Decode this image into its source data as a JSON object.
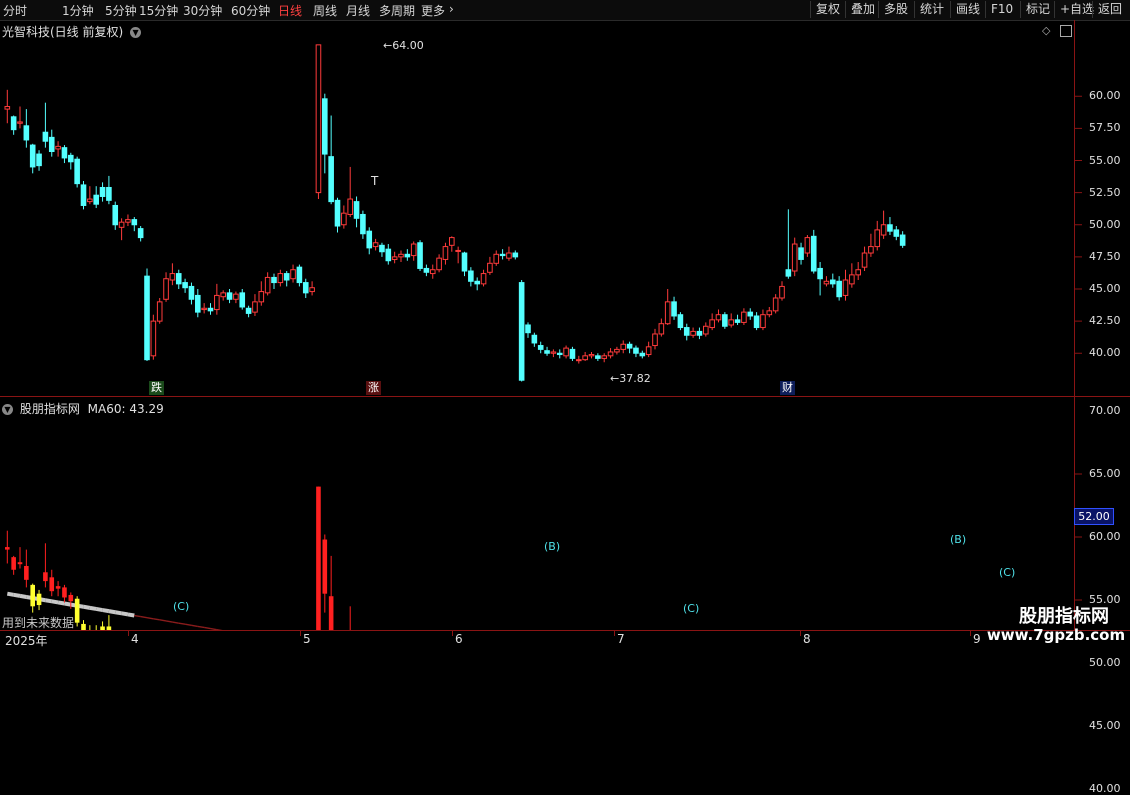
{
  "toolbar": {
    "left_items": [
      "分时",
      "1分钟",
      "5分钟",
      "15分钟",
      "30分钟",
      "60分钟",
      "日线",
      "周线",
      "月线",
      "多周期",
      "更多"
    ],
    "active": "日线",
    "right_items": [
      "复权",
      "叠加",
      "多股",
      "统计",
      "画线",
      "F10",
      "标记",
      "+自选",
      "返回"
    ]
  },
  "main_panel": {
    "title": "光智科技(日线 前复权)",
    "y_ticks": [
      "60.00",
      "57.50",
      "55.00",
      "52.50",
      "50.00",
      "47.50",
      "45.00",
      "42.50",
      "40.00"
    ],
    "high_label": "64.00",
    "low_label": "37.82",
    "markers": [
      {
        "text": "跌",
        "color": "#22aa22"
      },
      {
        "text": "涨",
        "color": "#dd2222"
      },
      {
        "text": "财",
        "color": "#2255dd"
      }
    ],
    "t_marker": "T"
  },
  "indicator_panel": {
    "title": "股朋指标网",
    "ma_label": "MA60: 43.29",
    "y_ticks": [
      "70.00",
      "65.00",
      "60.00",
      "55.00",
      "50.00",
      "45.00",
      "40.00"
    ],
    "current_price": "52.00",
    "wave_labels": [
      "(C)",
      "(B)",
      "(C)",
      "(B)",
      "(C)"
    ],
    "note": "用到未来数据"
  },
  "date_axis": [
    "2025年",
    "4",
    "5",
    "6",
    "7",
    "8",
    "9"
  ],
  "watermark": {
    "name": "股朋指标网",
    "url": "www.7gpzb.com"
  },
  "chart_data": {
    "type": "candlestick",
    "ylim": [
      37.0,
      65.0
    ],
    "candles": [
      [
        59.0,
        59.2,
        60.5,
        57.9
      ],
      [
        58.4,
        57.4,
        58.5,
        57.0
      ],
      [
        57.9,
        58.0,
        59.2,
        57.5
      ],
      [
        57.7,
        56.6,
        59.0,
        56.0
      ],
      [
        56.2,
        54.5,
        56.3,
        54.0
      ],
      [
        55.5,
        54.6,
        55.8,
        54.2
      ],
      [
        57.2,
        56.5,
        59.5,
        56.0
      ],
      [
        56.8,
        55.7,
        57.4,
        55.3
      ],
      [
        55.9,
        56.1,
        56.5,
        55.3
      ],
      [
        56.0,
        55.2,
        56.2,
        54.8
      ],
      [
        55.4,
        54.9,
        55.6,
        54.3
      ],
      [
        55.1,
        53.2,
        55.3,
        52.9
      ],
      [
        53.1,
        51.5,
        53.4,
        51.2
      ],
      [
        51.8,
        52.0,
        53.0,
        51.6
      ],
      [
        52.3,
        51.6,
        53.0,
        51.3
      ],
      [
        52.9,
        52.2,
        53.3,
        51.8
      ],
      [
        52.9,
        51.9,
        53.8,
        51.6
      ],
      [
        51.5,
        50.0,
        51.8,
        49.6
      ],
      [
        49.8,
        50.2,
        50.5,
        48.8
      ],
      [
        50.2,
        50.4,
        50.8,
        49.9
      ],
      [
        50.4,
        50.0,
        50.6,
        49.5
      ],
      [
        49.7,
        49.0,
        49.9,
        48.7
      ],
      [
        46.0,
        39.5,
        46.6,
        39.4
      ],
      [
        39.8,
        42.5,
        43.0,
        39.5
      ],
      [
        42.5,
        44.0,
        44.3,
        42.3
      ],
      [
        44.2,
        45.8,
        46.3,
        44.0
      ],
      [
        45.7,
        46.2,
        47.0,
        45.3
      ],
      [
        46.2,
        45.4,
        46.5,
        45.0
      ],
      [
        45.5,
        45.1,
        45.8,
        44.7
      ],
      [
        45.2,
        44.2,
        45.5,
        43.8
      ],
      [
        44.5,
        43.2,
        45.0,
        42.8
      ],
      [
        43.4,
        43.5,
        43.9,
        43.1
      ],
      [
        43.5,
        43.3,
        43.9,
        43.0
      ],
      [
        43.4,
        44.5,
        45.4,
        43.0
      ],
      [
        44.4,
        44.7,
        44.9,
        44.1
      ],
      [
        44.7,
        44.2,
        45.0,
        43.9
      ],
      [
        44.2,
        44.6,
        44.8,
        43.9
      ],
      [
        44.7,
        43.6,
        45.0,
        43.4
      ],
      [
        43.5,
        43.1,
        43.7,
        42.8
      ],
      [
        43.2,
        44.0,
        44.6,
        42.9
      ],
      [
        44.0,
        44.8,
        45.6,
        43.7
      ],
      [
        44.7,
        45.9,
        46.3,
        44.5
      ],
      [
        45.9,
        45.5,
        46.2,
        45.0
      ],
      [
        45.5,
        46.2,
        46.5,
        45.2
      ],
      [
        46.2,
        45.7,
        46.4,
        45.2
      ],
      [
        45.8,
        46.5,
        46.9,
        45.5
      ],
      [
        46.7,
        45.5,
        46.9,
        45.2
      ],
      [
        45.5,
        44.7,
        45.8,
        44.3
      ],
      [
        44.8,
        45.1,
        45.6,
        44.5
      ],
      [
        52.5,
        64.0,
        64.0,
        52.0
      ],
      [
        59.8,
        55.5,
        60.2,
        54.0
      ],
      [
        55.3,
        51.8,
        58.5,
        51.6
      ],
      [
        51.9,
        49.9,
        52.1,
        49.4
      ],
      [
        50.0,
        50.9,
        51.5,
        49.7
      ],
      [
        50.8,
        52.0,
        54.5,
        50.6
      ],
      [
        51.8,
        50.5,
        52.2,
        49.8
      ],
      [
        50.8,
        49.3,
        51.1,
        48.9
      ],
      [
        49.5,
        48.2,
        49.8,
        47.7
      ],
      [
        48.3,
        48.6,
        48.9,
        48.0
      ],
      [
        48.4,
        47.9,
        48.6,
        47.5
      ],
      [
        48.1,
        47.2,
        48.5,
        46.9
      ],
      [
        47.3,
        47.5,
        47.9,
        47.0
      ],
      [
        47.5,
        47.7,
        48.0,
        47.1
      ],
      [
        47.7,
        47.5,
        48.1,
        47.2
      ],
      [
        47.6,
        48.5,
        48.7,
        47.2
      ],
      [
        48.6,
        46.6,
        48.8,
        46.4
      ],
      [
        46.6,
        46.3,
        46.9,
        46.0
      ],
      [
        46.2,
        46.5,
        46.9,
        45.8
      ],
      [
        46.5,
        47.4,
        47.7,
        46.3
      ],
      [
        47.3,
        48.3,
        48.6,
        46.9
      ],
      [
        48.4,
        49.0,
        49.1,
        47.9
      ],
      [
        48.0,
        48.0,
        48.3,
        47.0
      ],
      [
        47.8,
        46.4,
        47.9,
        46.0
      ],
      [
        46.4,
        45.6,
        46.7,
        45.2
      ],
      [
        45.6,
        45.4,
        45.9,
        44.9
      ],
      [
        45.4,
        46.2,
        46.5,
        45.2
      ],
      [
        46.3,
        47.0,
        47.5,
        46.1
      ],
      [
        47.0,
        47.7,
        48.0,
        46.8
      ],
      [
        47.7,
        47.6,
        48.1,
        47.3
      ],
      [
        47.4,
        47.8,
        48.3,
        47.2
      ],
      [
        47.8,
        47.5,
        48.0,
        47.3
      ],
      [
        45.5,
        37.9,
        45.7,
        37.8
      ],
      [
        42.2,
        41.6,
        42.4,
        41.2
      ],
      [
        41.4,
        40.8,
        41.6,
        40.5
      ],
      [
        40.6,
        40.3,
        40.9,
        40.0
      ],
      [
        40.2,
        40.0,
        40.5,
        39.8
      ],
      [
        40.0,
        40.1,
        40.3,
        39.7
      ],
      [
        40.0,
        39.9,
        40.3,
        39.6
      ],
      [
        39.8,
        40.4,
        40.6,
        39.6
      ],
      [
        40.3,
        39.6,
        40.5,
        39.4
      ],
      [
        39.5,
        39.5,
        39.8,
        39.2
      ],
      [
        39.5,
        39.8,
        40.1,
        39.4
      ],
      [
        39.8,
        39.9,
        40.1,
        39.6
      ],
      [
        39.8,
        39.6,
        40.0,
        39.4
      ],
      [
        39.6,
        39.8,
        40.0,
        39.3
      ],
      [
        39.8,
        40.1,
        40.4,
        39.6
      ],
      [
        40.1,
        40.3,
        40.5,
        39.9
      ],
      [
        40.3,
        40.7,
        41.0,
        40.0
      ],
      [
        40.7,
        40.4,
        40.9,
        40.0
      ],
      [
        40.4,
        40.0,
        40.6,
        39.7
      ],
      [
        40.0,
        39.8,
        40.2,
        39.6
      ],
      [
        39.9,
        40.5,
        40.9,
        39.7
      ],
      [
        40.6,
        41.5,
        41.9,
        40.3
      ],
      [
        41.5,
        42.3,
        42.7,
        41.3
      ],
      [
        42.3,
        44.0,
        45.0,
        42.2
      ],
      [
        44.0,
        42.9,
        44.4,
        42.6
      ],
      [
        43.0,
        42.0,
        43.2,
        41.8
      ],
      [
        42.0,
        41.4,
        42.3,
        41.0
      ],
      [
        41.4,
        41.7,
        42.0,
        41.2
      ],
      [
        41.7,
        41.4,
        42.0,
        41.1
      ],
      [
        41.5,
        42.1,
        42.4,
        41.3
      ],
      [
        42.0,
        42.6,
        43.1,
        41.8
      ],
      [
        42.6,
        43.0,
        43.4,
        42.4
      ],
      [
        43.0,
        42.1,
        43.2,
        41.9
      ],
      [
        42.2,
        42.6,
        43.1,
        42.0
      ],
      [
        42.6,
        42.4,
        43.0,
        42.2
      ],
      [
        42.4,
        43.2,
        43.5,
        42.2
      ],
      [
        43.2,
        42.9,
        43.5,
        42.6
      ],
      [
        42.9,
        42.0,
        43.2,
        41.8
      ],
      [
        42.0,
        43.0,
        43.4,
        41.8
      ],
      [
        43.0,
        43.3,
        43.6,
        42.8
      ],
      [
        43.3,
        44.3,
        44.6,
        43.1
      ],
      [
        44.3,
        45.2,
        45.6,
        44.1
      ],
      [
        46.5,
        46.0,
        51.2,
        45.8
      ],
      [
        46.4,
        48.5,
        49.0,
        46.0
      ],
      [
        48.2,
        47.3,
        48.6,
        46.9
      ],
      [
        47.8,
        49.0,
        49.2,
        47.5
      ],
      [
        49.1,
        46.4,
        49.6,
        46.2
      ],
      [
        46.6,
        45.8,
        47.1,
        44.5
      ],
      [
        45.4,
        45.6,
        46.0,
        45.2
      ],
      [
        45.7,
        45.4,
        46.2,
        45.1
      ],
      [
        45.6,
        44.4,
        46.0,
        44.1
      ],
      [
        44.5,
        45.7,
        46.5,
        44.1
      ],
      [
        45.4,
        46.1,
        47.0,
        45.1
      ],
      [
        46.1,
        46.5,
        47.1,
        45.7
      ],
      [
        46.7,
        47.8,
        48.3,
        46.4
      ],
      [
        47.8,
        48.3,
        49.3,
        47.5
      ],
      [
        48.3,
        49.6,
        50.3,
        48.0
      ],
      [
        49.2,
        50.0,
        51.1,
        48.9
      ],
      [
        50.0,
        49.5,
        50.6,
        49.2
      ],
      [
        49.6,
        49.1,
        49.9,
        48.8
      ],
      [
        49.2,
        48.4,
        49.5,
        48.2
      ]
    ],
    "ma60_start": 55.5,
    "ma60_end": 43.3
  }
}
